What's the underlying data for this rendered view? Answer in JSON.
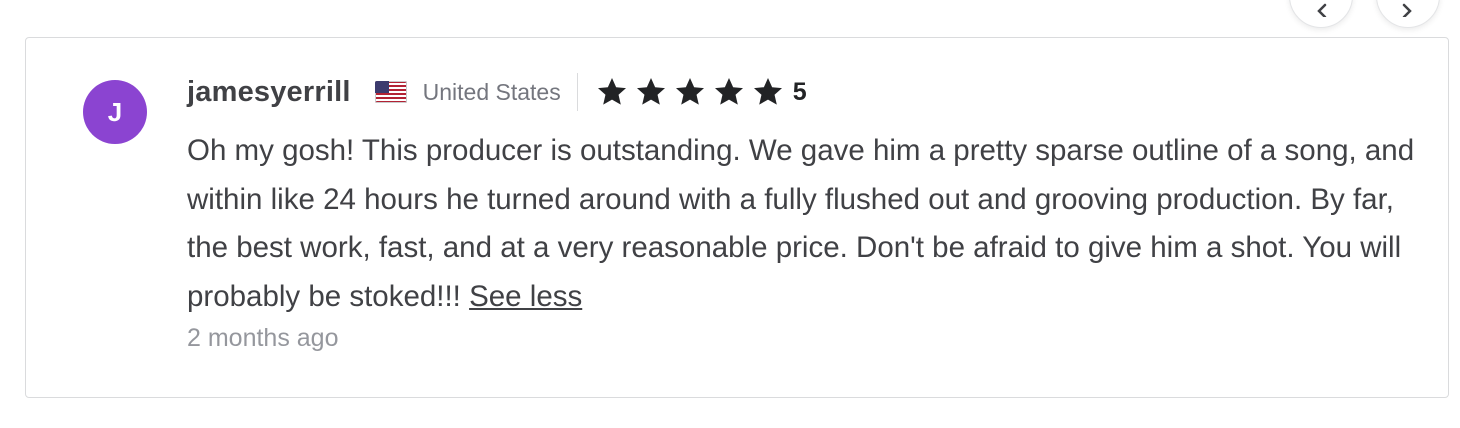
{
  "carousel": {
    "prev_icon": "chevron-left-icon",
    "next_icon": "chevron-right-icon"
  },
  "review": {
    "avatar_initial": "J",
    "avatar_color": "#8b44d1",
    "username": "jamesyerrill",
    "country": "United States",
    "country_flag_icon": "us-flag-icon",
    "star_icon": "star-icon",
    "stars": 5,
    "rating": "5",
    "text": "Oh my gosh! This producer is outstanding. We gave him a pretty sparse outline of a song, and within like 24 hours he turned around with a fully flushed out and grooving production. By far, the best work, fast, and at a very reasonable price. Don't be afraid to give him a shot. You will probably be stoked!!!",
    "see_less_label": "See less",
    "time_ago": "2 months ago"
  }
}
